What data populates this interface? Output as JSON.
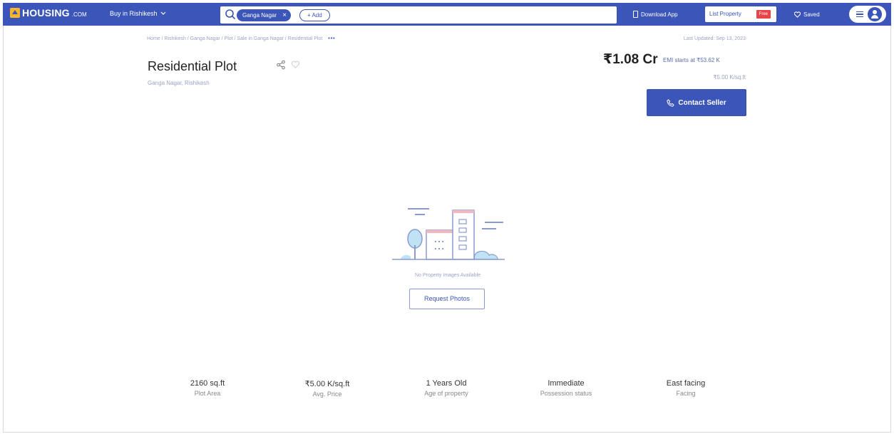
{
  "header": {
    "logo_text": "HOUSING",
    "logo_suffix": ".COM",
    "city_select": "Buy in Rishikesh",
    "search_chip": "Ganga Nagar",
    "add_chip": "+ Add",
    "download_app": "Download App",
    "list_property": "List Property",
    "free_badge": "Free",
    "saved": "Saved"
  },
  "breadcrumb": {
    "path": "Home / Rishikesh / Ganga Nagar / Plot / Sale in Ganga Nagar / Residential Plot",
    "more": "•••"
  },
  "listing": {
    "last_updated": "Last Updated: Sep 13, 2023",
    "title": "Residential Plot",
    "locality": "Ganga Nagar, Rishikesh",
    "price": "₹1.08 Cr",
    "emi": "EMI starts at ₹53.62 K",
    "rate": "₹5.00 K/sq.ft",
    "contact_button": "Contact Seller"
  },
  "media": {
    "no_images": "No Property Images Available",
    "request_button": "Request Photos"
  },
  "stats": [
    {
      "value": "2160 sq.ft",
      "label": "Plot Area"
    },
    {
      "value": "₹5.00 K/sq.ft",
      "label": "Avg. Price"
    },
    {
      "value": "1 Years Old",
      "label": "Age of property"
    },
    {
      "value": "Immediate",
      "label": "Possession status"
    },
    {
      "value": "East facing",
      "label": "Facing"
    }
  ],
  "colors": {
    "brand": "#3b55b8",
    "logo_accent": "#f7b52c",
    "free_badge": "#e8454a"
  }
}
